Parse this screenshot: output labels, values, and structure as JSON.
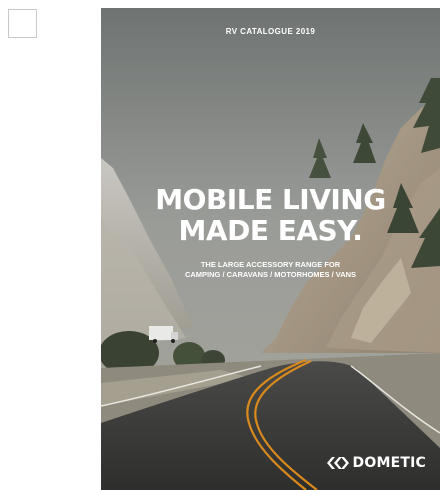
{
  "cover": {
    "catalogue_label": "RV CATALOGUE 2019",
    "headline": {
      "line1": "MOBILE LIVING",
      "line2": "MADE EASY."
    },
    "subtitle": {
      "line1": "THE LARGE ACCESSORY RANGE FOR",
      "line2": "CAMPING / CARAVANS / MOTORHOMES / VANS"
    },
    "brand": "DOMETIC"
  },
  "colors": {
    "text": "#ffffff",
    "road_line": "#d98a1c",
    "sky": "#7f8482"
  }
}
